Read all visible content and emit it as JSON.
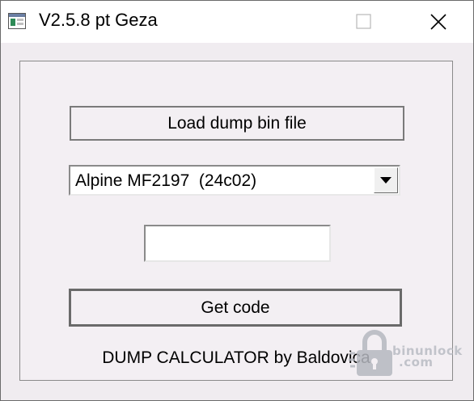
{
  "window": {
    "title": "V2.5.8 pt Geza",
    "icons": {
      "app": "app-window-icon",
      "maximize": "maximize-icon",
      "close": "close-icon"
    }
  },
  "main": {
    "load_button_label": "Load dump bin file",
    "model_select": {
      "selected": "Alpine MF2197  (24c02)",
      "arrow_icon": "dropdown-arrow-icon"
    },
    "code_field_value": "",
    "get_code_label": "Get code",
    "credit_text": "DUMP CALCULATOR by Baldovica"
  },
  "watermark": {
    "line1": "binunlock",
    "line2": ".com"
  },
  "colors": {
    "client_bg": "#f3eff3",
    "window_bg": "#f0ecf0",
    "titlebar_bg": "#ffffff",
    "border": "#7a7a7a"
  }
}
